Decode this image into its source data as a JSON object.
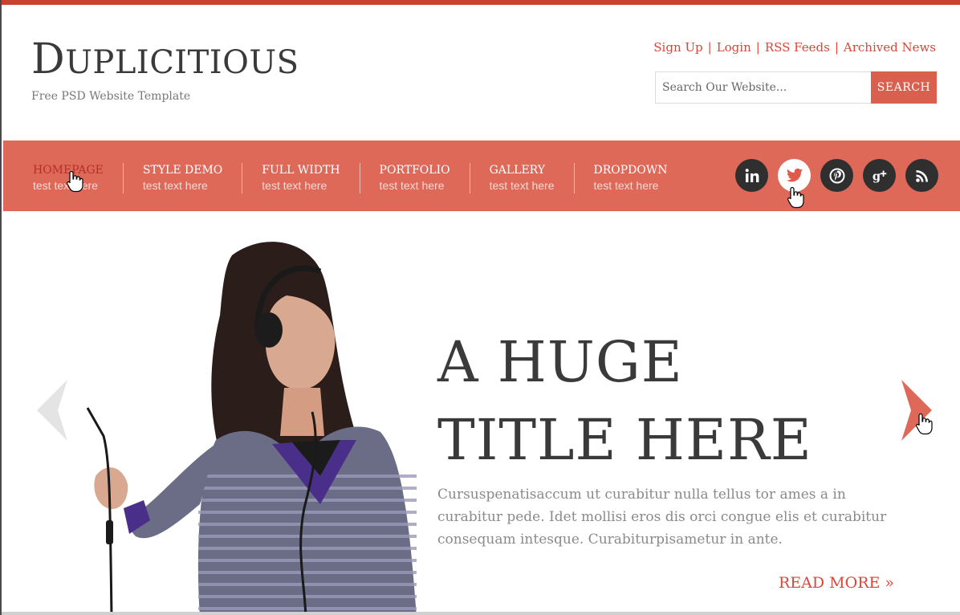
{
  "header": {
    "logo_first": "D",
    "logo_rest": "UPLICITIOUS",
    "tagline": "Free PSD Website Template",
    "links": [
      "Sign Up",
      "Login",
      "RSS Feeds",
      "Archived News"
    ],
    "link_separator": "|",
    "search": {
      "placeholder": "Search Our Website...",
      "button_label": "SEARCH"
    }
  },
  "nav": {
    "items": [
      {
        "title": "HOMEPAGE",
        "sub": "test text here",
        "active": true
      },
      {
        "title": "STYLE DEMO",
        "sub": "test text here"
      },
      {
        "title": "FULL WIDTH",
        "sub": "test text here"
      },
      {
        "title": "PORTFOLIO",
        "sub": "test text here"
      },
      {
        "title": "GALLERY",
        "sub": "test text here"
      },
      {
        "title": "DROPDOWN",
        "sub": "test text here"
      }
    ],
    "socials": [
      {
        "name": "linkedin-icon",
        "glyph": "in"
      },
      {
        "name": "twitter-icon",
        "glyph": "t"
      },
      {
        "name": "pinterest-icon",
        "glyph": "p"
      },
      {
        "name": "google-plus-icon",
        "glyph": "g+"
      },
      {
        "name": "rss-icon",
        "glyph": "rss"
      }
    ]
  },
  "hero": {
    "title_line1": "A HUGE",
    "title_line2": "TITLE HERE",
    "text": "Cursuspenatisaccum ut curabitur nulla tellus tor ames a in curabitur pede. Idet mollisi eros dis orci congue elis et curabitur consequam intesque. Curabiturpisametur in ante.",
    "read_more": "READ MORE »"
  },
  "colors": {
    "accent": "#d9473a",
    "nav_bg": "#df6959",
    "social_bg": "#2f2f2f",
    "heading": "#3a3a3a"
  }
}
